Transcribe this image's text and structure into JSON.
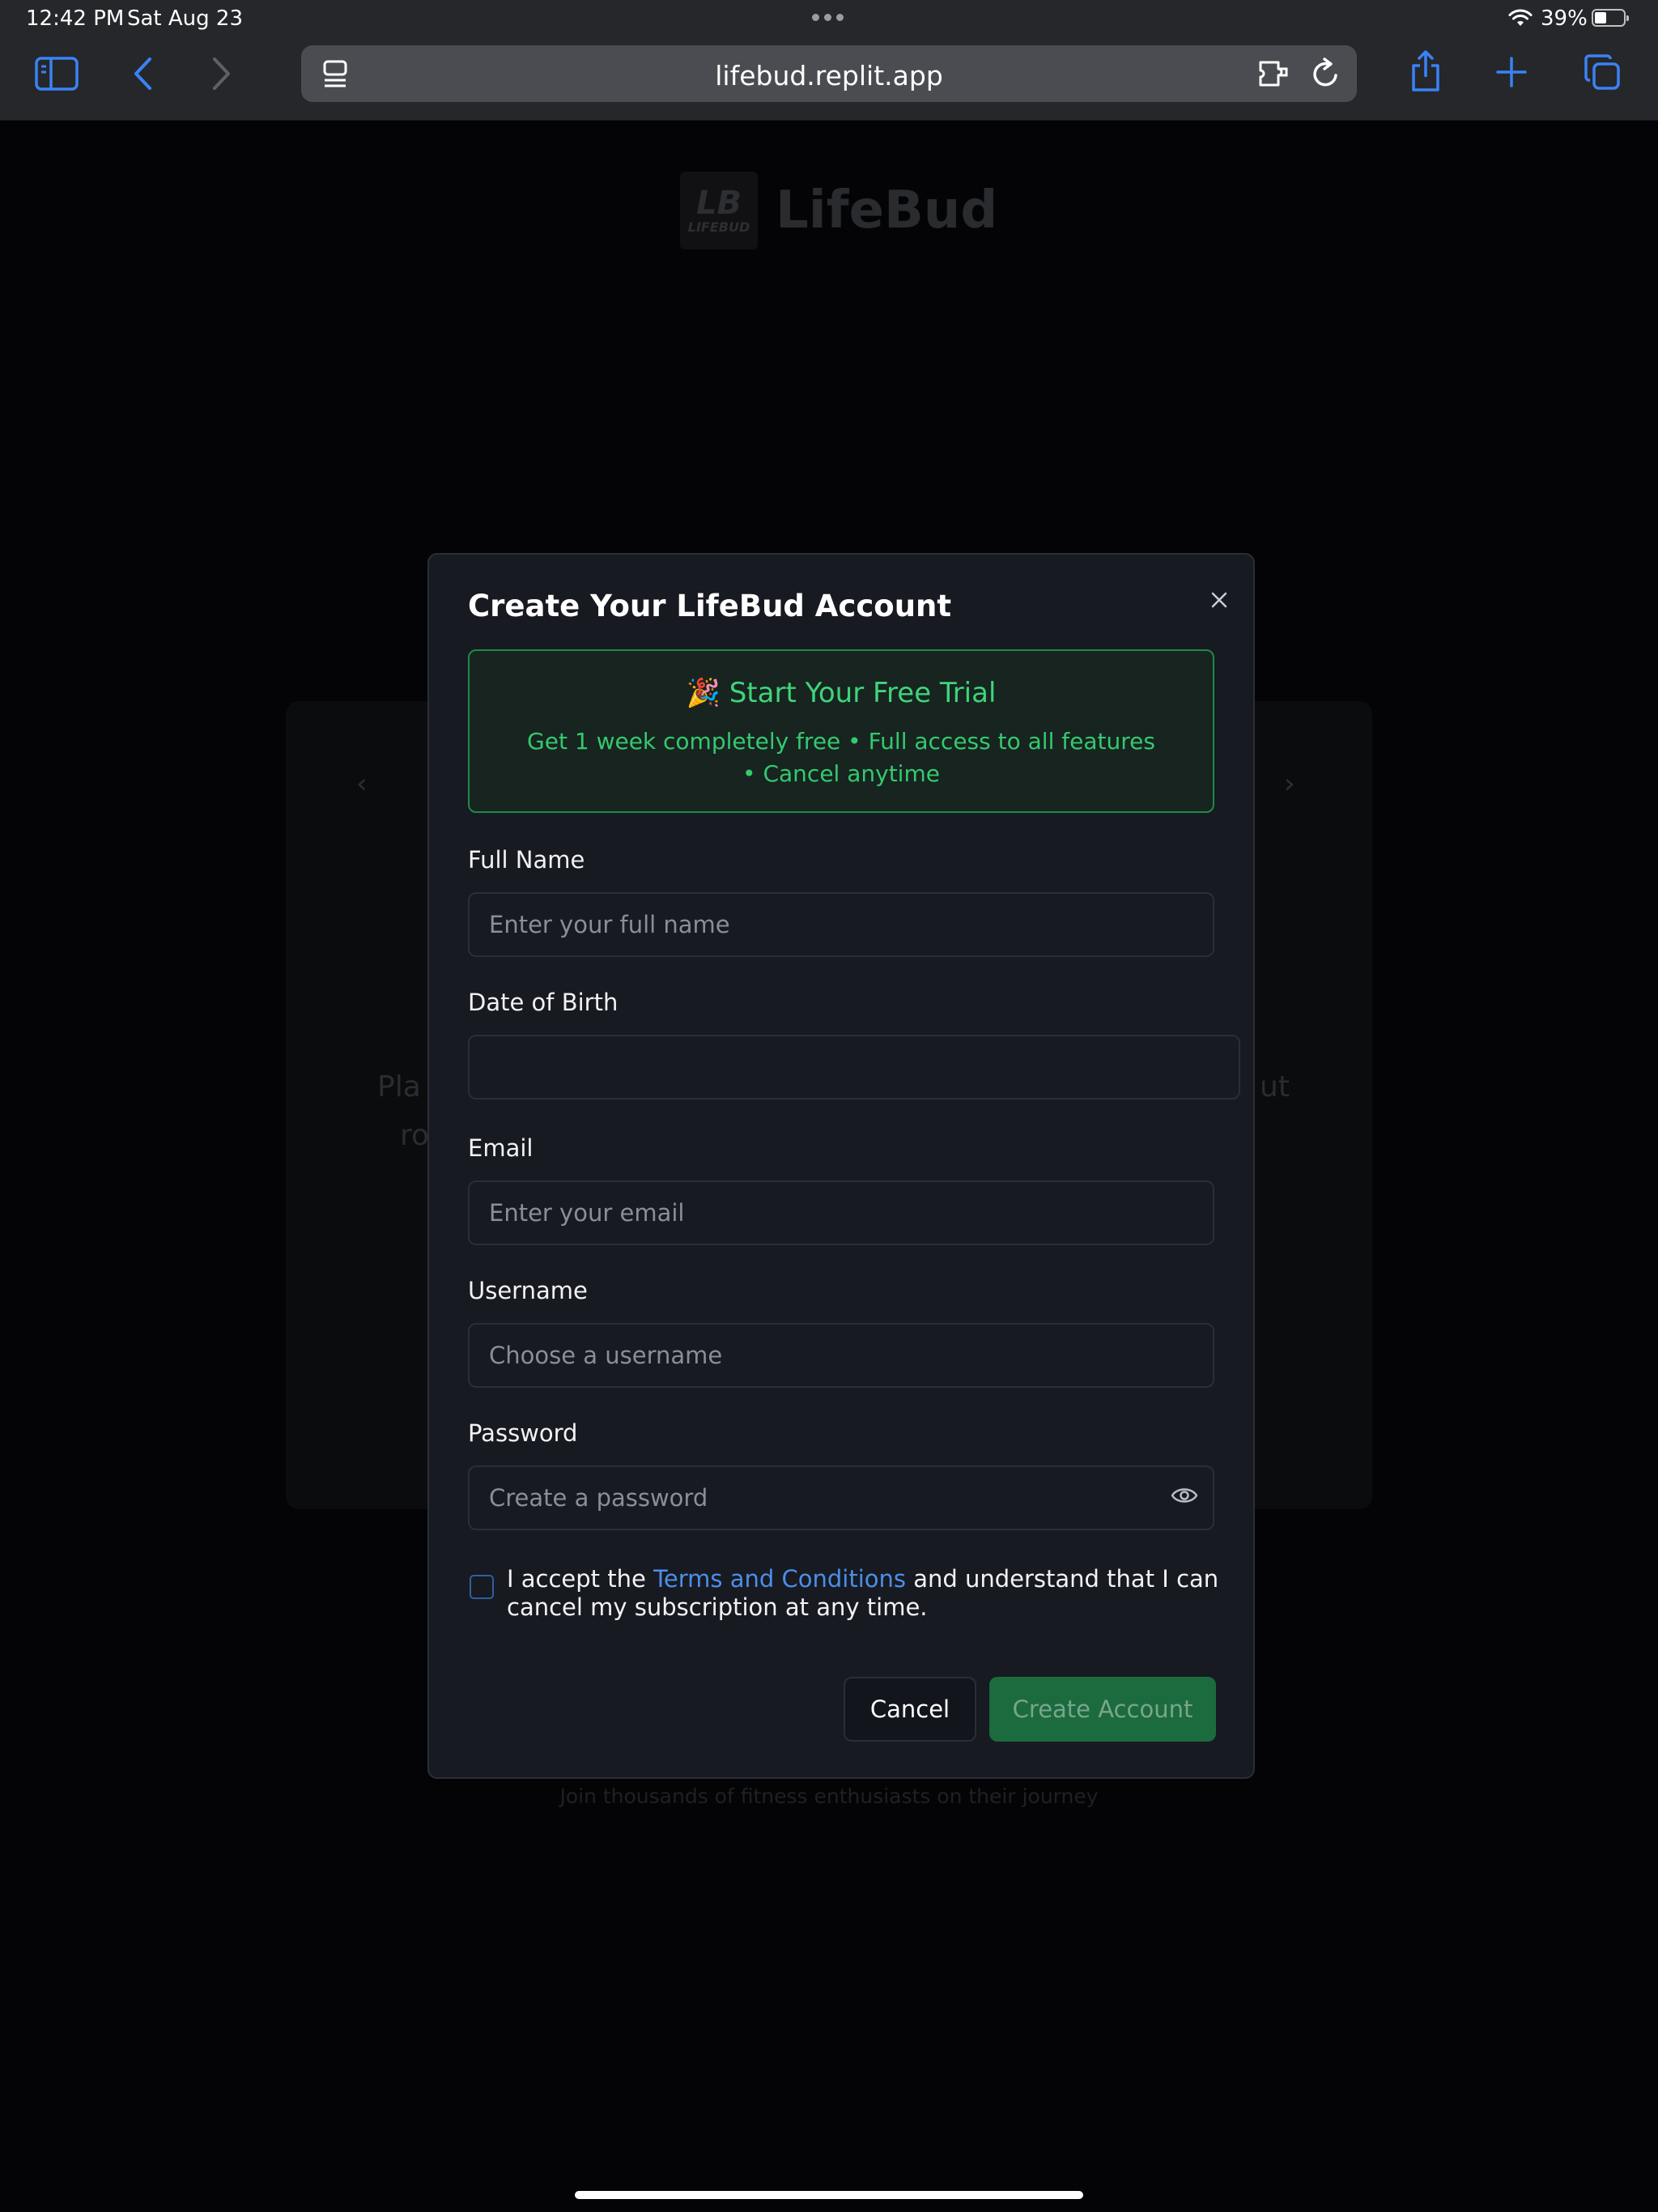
{
  "status_bar": {
    "time": "12:42 PM",
    "date": "Sat Aug 23",
    "battery_percent": "39%",
    "battery_level": 0.39,
    "icons": [
      "wifi-icon",
      "battery-icon",
      "more-dots-icon"
    ]
  },
  "browser": {
    "url": "lifebud.replit.app",
    "toolbar_icons": [
      "sidebar-icon",
      "back-icon",
      "forward-icon",
      "reader-icon",
      "extension-icon",
      "reload-icon",
      "share-icon",
      "new-tab-icon",
      "tabs-icon"
    ],
    "accent_color": "#3b82f6"
  },
  "background_page": {
    "logo_mark_big": "LB",
    "logo_mark_small": "LIFEBUD",
    "brand_name": "LifeBud",
    "carousel_prev": "‹",
    "carousel_next": "›",
    "fragment_1": "Pla",
    "fragment_2": "ro",
    "fragment_3": "ut",
    "footer": "Join thousands of fitness enthusiasts on their journey"
  },
  "modal": {
    "title": "Create Your LifeBud Account",
    "close_icon": "close-icon",
    "trial_banner": {
      "title": "🎉 Start Your Free Trial",
      "description": "Get 1 week completely free • Full access to all features • Cancel anytime",
      "color": "#22c55e"
    },
    "fields": {
      "full_name": {
        "label": "Full Name",
        "placeholder": "Enter your full name",
        "value": ""
      },
      "date_of_birth": {
        "label": "Date of Birth",
        "value": ""
      },
      "email": {
        "label": "Email",
        "placeholder": "Enter your email",
        "value": ""
      },
      "username": {
        "label": "Username",
        "placeholder": "Choose a username",
        "value": ""
      },
      "password": {
        "label": "Password",
        "placeholder": "Create a password",
        "value": "",
        "toggle_icon": "eye-icon"
      }
    },
    "terms": {
      "checked": false,
      "prefix": "I accept the ",
      "link": "Terms and Conditions",
      "suffix": " and understand that I can cancel my subscription at any time."
    },
    "buttons": {
      "cancel": "Cancel",
      "create": "Create Account",
      "create_color": "#1b6b3e"
    }
  }
}
